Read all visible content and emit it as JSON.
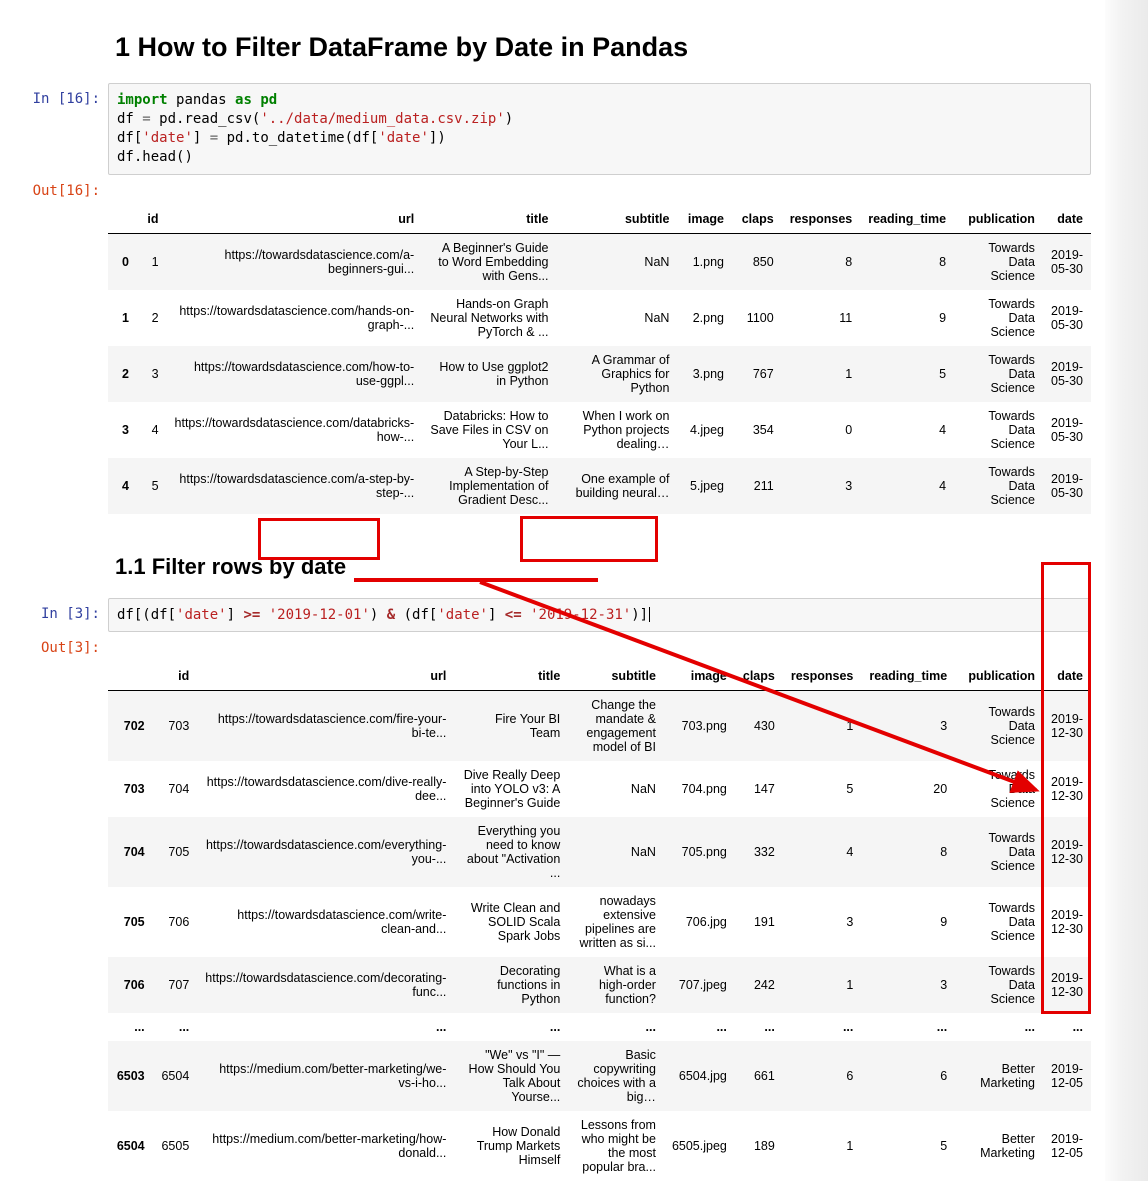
{
  "heading1": "1  How to Filter DataFrame by Date in Pandas",
  "heading2": "1.1  Filter rows by date",
  "prompt_in_16": "In [16]:",
  "prompt_out_16": "Out[16]:",
  "prompt_in_3": "In [3]:",
  "prompt_out_3": "Out[3]:",
  "code1": {
    "import": "import",
    "pandas": "pandas",
    "as": "as",
    "pd": "pd",
    "line2a": "df ",
    "line2b": "=",
    "line2c": " pd.read_csv(",
    "line2s": "'../data/medium_data.csv.zip'",
    "line2d": ")",
    "line3a": "df[",
    "line3s1": "'date'",
    "line3b": "] ",
    "line3c": "=",
    "line3d": " pd.to_datetime(df[",
    "line3s2": "'date'",
    "line3e": "])",
    "line4a": "df.head",
    "line4b": "()"
  },
  "code2": {
    "pre1": "df[(df[",
    "s1": "'date'",
    "pre2": "] ",
    "op1": ">=",
    "pre3": " ",
    "s2": "'2019-12-01'",
    "pre4": ") ",
    "amp": "&",
    "pre5": " (df[",
    "s3": "'date'",
    "pre6": "] ",
    "op2": "<=",
    "pre7": " ",
    "s4": "'2019-12-31'",
    "pre8": ")]"
  },
  "table1": {
    "headers": [
      "",
      "id",
      "url",
      "title",
      "subtitle",
      "image",
      "claps",
      "responses",
      "reading_time",
      "publication",
      "date"
    ],
    "rows": [
      {
        "idx": "0",
        "id": "1",
        "url": "https://towardsdatascience.com/a-beginners-gui...",
        "title": "A Beginner's Guide to Word Embedding with Gens...",
        "subtitle": "NaN",
        "image": "1.png",
        "claps": "850",
        "responses": "8",
        "reading_time": "8",
        "publication": "Towards Data Science",
        "date": "2019-05-30"
      },
      {
        "idx": "1",
        "id": "2",
        "url": "https://towardsdatascience.com/hands-on-graph-...",
        "title": "Hands-on Graph Neural Networks with PyTorch & ...",
        "subtitle": "NaN",
        "image": "2.png",
        "claps": "1100",
        "responses": "11",
        "reading_time": "9",
        "publication": "Towards Data Science",
        "date": "2019-05-30"
      },
      {
        "idx": "2",
        "id": "3",
        "url": "https://towardsdatascience.com/how-to-use-ggpl...",
        "title": "How to Use ggplot2 in Python",
        "subtitle": "A Grammar of Graphics for Python",
        "image": "3.png",
        "claps": "767",
        "responses": "1",
        "reading_time": "5",
        "publication": "Towards Data Science",
        "date": "2019-05-30"
      },
      {
        "idx": "3",
        "id": "4",
        "url": "https://towardsdatascience.com/databricks-how-...",
        "title": "Databricks: How to Save Files in CSV on Your L...",
        "subtitle": "When I work on Python projects dealing…",
        "image": "4.jpeg",
        "claps": "354",
        "responses": "0",
        "reading_time": "4",
        "publication": "Towards Data Science",
        "date": "2019-05-30"
      },
      {
        "idx": "4",
        "id": "5",
        "url": "https://towardsdatascience.com/a-step-by-step-...",
        "title": "A Step-by-Step Implementation of Gradient Desc...",
        "subtitle": "One example of building neural…",
        "image": "5.jpeg",
        "claps": "211",
        "responses": "3",
        "reading_time": "4",
        "publication": "Towards Data Science",
        "date": "2019-05-30"
      }
    ]
  },
  "table2": {
    "headers": [
      "",
      "id",
      "url",
      "title",
      "subtitle",
      "image",
      "claps",
      "responses",
      "reading_time",
      "publication",
      "date"
    ],
    "rows": [
      {
        "idx": "702",
        "id": "703",
        "url": "https://towardsdatascience.com/fire-your-bi-te...",
        "title": "Fire Your BI Team",
        "subtitle": "Change the mandate & engagement model of BI",
        "image": "703.png",
        "claps": "430",
        "responses": "1",
        "reading_time": "3",
        "publication": "Towards Data Science",
        "date": "2019-12-30"
      },
      {
        "idx": "703",
        "id": "704",
        "url": "https://towardsdatascience.com/dive-really-dee...",
        "title": "Dive Really Deep into YOLO v3: A Beginner's Guide",
        "subtitle": "NaN",
        "image": "704.png",
        "claps": "147",
        "responses": "5",
        "reading_time": "20",
        "publication": "Towards Data Science",
        "date": "2019-12-30"
      },
      {
        "idx": "704",
        "id": "705",
        "url": "https://towardsdatascience.com/everything-you-...",
        "title": "Everything you need to know about \"Activation ...",
        "subtitle": "NaN",
        "image": "705.png",
        "claps": "332",
        "responses": "4",
        "reading_time": "8",
        "publication": "Towards Data Science",
        "date": "2019-12-30"
      },
      {
        "idx": "705",
        "id": "706",
        "url": "https://towardsdatascience.com/write-clean-and...",
        "title": "Write Clean and SOLID Scala Spark Jobs",
        "subtitle": "nowadays extensive pipelines are written as si...",
        "image": "706.jpg",
        "claps": "191",
        "responses": "3",
        "reading_time": "9",
        "publication": "Towards Data Science",
        "date": "2019-12-30"
      },
      {
        "idx": "706",
        "id": "707",
        "url": "https://towardsdatascience.com/decorating-func...",
        "title": "Decorating functions in Python",
        "subtitle": "What is a high-order function?",
        "image": "707.jpeg",
        "claps": "242",
        "responses": "1",
        "reading_time": "3",
        "publication": "Towards Data Science",
        "date": "2019-12-30"
      },
      {
        "idx": "...",
        "id": "...",
        "url": "...",
        "title": "...",
        "subtitle": "...",
        "image": "...",
        "claps": "...",
        "responses": "...",
        "reading_time": "...",
        "publication": "...",
        "date": "..."
      },
      {
        "idx": "6503",
        "id": "6504",
        "url": "https://medium.com/better-marketing/we-vs-i-ho...",
        "title": "\"We\" vs \"I\" — How Should You Talk About Yourse...",
        "subtitle": "Basic copywriting choices with a big…",
        "image": "6504.jpg",
        "claps": "661",
        "responses": "6",
        "reading_time": "6",
        "publication": "Better Marketing",
        "date": "2019-12-05"
      },
      {
        "idx": "6504",
        "id": "6505",
        "url": "https://medium.com/better-marketing/how-donald...",
        "title": "How Donald Trump Markets Himself",
        "subtitle": "Lessons from who might be the most popular bra...",
        "image": "6505.jpeg",
        "claps": "189",
        "responses": "1",
        "reading_time": "5",
        "publication": "Better Marketing",
        "date": "2019-12-05"
      }
    ]
  }
}
